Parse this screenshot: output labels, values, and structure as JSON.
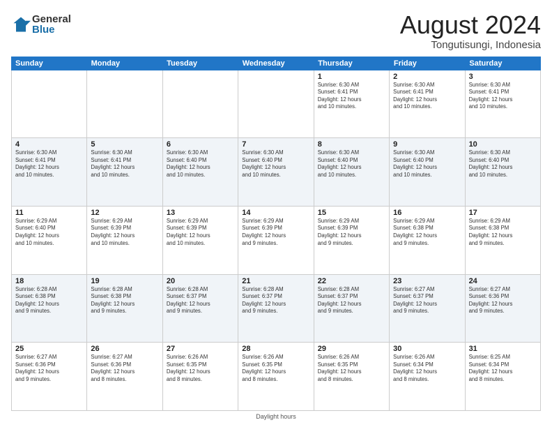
{
  "logo": {
    "general": "General",
    "blue": "Blue"
  },
  "title": "August 2024",
  "location": "Tongutisungi, Indonesia",
  "days": [
    "Sunday",
    "Monday",
    "Tuesday",
    "Wednesday",
    "Thursday",
    "Friday",
    "Saturday"
  ],
  "footer": "Daylight hours",
  "weeks": [
    {
      "altRow": false,
      "cells": [
        {
          "day": "",
          "info": ""
        },
        {
          "day": "",
          "info": ""
        },
        {
          "day": "",
          "info": ""
        },
        {
          "day": "",
          "info": ""
        },
        {
          "day": "1",
          "info": "Sunrise: 6:30 AM\nSunset: 6:41 PM\nDaylight: 12 hours\nand 10 minutes."
        },
        {
          "day": "2",
          "info": "Sunrise: 6:30 AM\nSunset: 6:41 PM\nDaylight: 12 hours\nand 10 minutes."
        },
        {
          "day": "3",
          "info": "Sunrise: 6:30 AM\nSunset: 6:41 PM\nDaylight: 12 hours\nand 10 minutes."
        }
      ]
    },
    {
      "altRow": true,
      "cells": [
        {
          "day": "4",
          "info": "Sunrise: 6:30 AM\nSunset: 6:41 PM\nDaylight: 12 hours\nand 10 minutes."
        },
        {
          "day": "5",
          "info": "Sunrise: 6:30 AM\nSunset: 6:41 PM\nDaylight: 12 hours\nand 10 minutes."
        },
        {
          "day": "6",
          "info": "Sunrise: 6:30 AM\nSunset: 6:40 PM\nDaylight: 12 hours\nand 10 minutes."
        },
        {
          "day": "7",
          "info": "Sunrise: 6:30 AM\nSunset: 6:40 PM\nDaylight: 12 hours\nand 10 minutes."
        },
        {
          "day": "8",
          "info": "Sunrise: 6:30 AM\nSunset: 6:40 PM\nDaylight: 12 hours\nand 10 minutes."
        },
        {
          "day": "9",
          "info": "Sunrise: 6:30 AM\nSunset: 6:40 PM\nDaylight: 12 hours\nand 10 minutes."
        },
        {
          "day": "10",
          "info": "Sunrise: 6:30 AM\nSunset: 6:40 PM\nDaylight: 12 hours\nand 10 minutes."
        }
      ]
    },
    {
      "altRow": false,
      "cells": [
        {
          "day": "11",
          "info": "Sunrise: 6:29 AM\nSunset: 6:40 PM\nDaylight: 12 hours\nand 10 minutes."
        },
        {
          "day": "12",
          "info": "Sunrise: 6:29 AM\nSunset: 6:39 PM\nDaylight: 12 hours\nand 10 minutes."
        },
        {
          "day": "13",
          "info": "Sunrise: 6:29 AM\nSunset: 6:39 PM\nDaylight: 12 hours\nand 10 minutes."
        },
        {
          "day": "14",
          "info": "Sunrise: 6:29 AM\nSunset: 6:39 PM\nDaylight: 12 hours\nand 9 minutes."
        },
        {
          "day": "15",
          "info": "Sunrise: 6:29 AM\nSunset: 6:39 PM\nDaylight: 12 hours\nand 9 minutes."
        },
        {
          "day": "16",
          "info": "Sunrise: 6:29 AM\nSunset: 6:38 PM\nDaylight: 12 hours\nand 9 minutes."
        },
        {
          "day": "17",
          "info": "Sunrise: 6:29 AM\nSunset: 6:38 PM\nDaylight: 12 hours\nand 9 minutes."
        }
      ]
    },
    {
      "altRow": true,
      "cells": [
        {
          "day": "18",
          "info": "Sunrise: 6:28 AM\nSunset: 6:38 PM\nDaylight: 12 hours\nand 9 minutes."
        },
        {
          "day": "19",
          "info": "Sunrise: 6:28 AM\nSunset: 6:38 PM\nDaylight: 12 hours\nand 9 minutes."
        },
        {
          "day": "20",
          "info": "Sunrise: 6:28 AM\nSunset: 6:37 PM\nDaylight: 12 hours\nand 9 minutes."
        },
        {
          "day": "21",
          "info": "Sunrise: 6:28 AM\nSunset: 6:37 PM\nDaylight: 12 hours\nand 9 minutes."
        },
        {
          "day": "22",
          "info": "Sunrise: 6:28 AM\nSunset: 6:37 PM\nDaylight: 12 hours\nand 9 minutes."
        },
        {
          "day": "23",
          "info": "Sunrise: 6:27 AM\nSunset: 6:37 PM\nDaylight: 12 hours\nand 9 minutes."
        },
        {
          "day": "24",
          "info": "Sunrise: 6:27 AM\nSunset: 6:36 PM\nDaylight: 12 hours\nand 9 minutes."
        }
      ]
    },
    {
      "altRow": false,
      "cells": [
        {
          "day": "25",
          "info": "Sunrise: 6:27 AM\nSunset: 6:36 PM\nDaylight: 12 hours\nand 9 minutes."
        },
        {
          "day": "26",
          "info": "Sunrise: 6:27 AM\nSunset: 6:36 PM\nDaylight: 12 hours\nand 8 minutes."
        },
        {
          "day": "27",
          "info": "Sunrise: 6:26 AM\nSunset: 6:35 PM\nDaylight: 12 hours\nand 8 minutes."
        },
        {
          "day": "28",
          "info": "Sunrise: 6:26 AM\nSunset: 6:35 PM\nDaylight: 12 hours\nand 8 minutes."
        },
        {
          "day": "29",
          "info": "Sunrise: 6:26 AM\nSunset: 6:35 PM\nDaylight: 12 hours\nand 8 minutes."
        },
        {
          "day": "30",
          "info": "Sunrise: 6:26 AM\nSunset: 6:34 PM\nDaylight: 12 hours\nand 8 minutes."
        },
        {
          "day": "31",
          "info": "Sunrise: 6:25 AM\nSunset: 6:34 PM\nDaylight: 12 hours\nand 8 minutes."
        }
      ]
    }
  ]
}
